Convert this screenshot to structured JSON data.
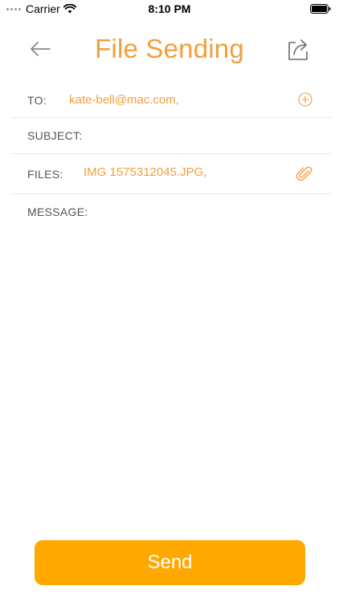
{
  "status_bar": {
    "carrier": "Carrier",
    "time": "8:10 PM"
  },
  "header": {
    "title": "File Sending",
    "back_icon": "arrow-left-icon",
    "share_icon": "share-icon"
  },
  "form": {
    "to_label": "TO:",
    "to_value": "kate-bell@mac.com,",
    "add_icon": "plus-circle-icon",
    "subject_label": "SUBJECT:",
    "files_label": "FILES:",
    "files_value": "IMG 1575312045.JPG,",
    "attach_icon": "paperclip-icon",
    "message_label": "MESSAGE:"
  },
  "actions": {
    "send_label": "Send"
  },
  "colors": {
    "accent": "#f29f3a",
    "send_button": "#fea800"
  }
}
